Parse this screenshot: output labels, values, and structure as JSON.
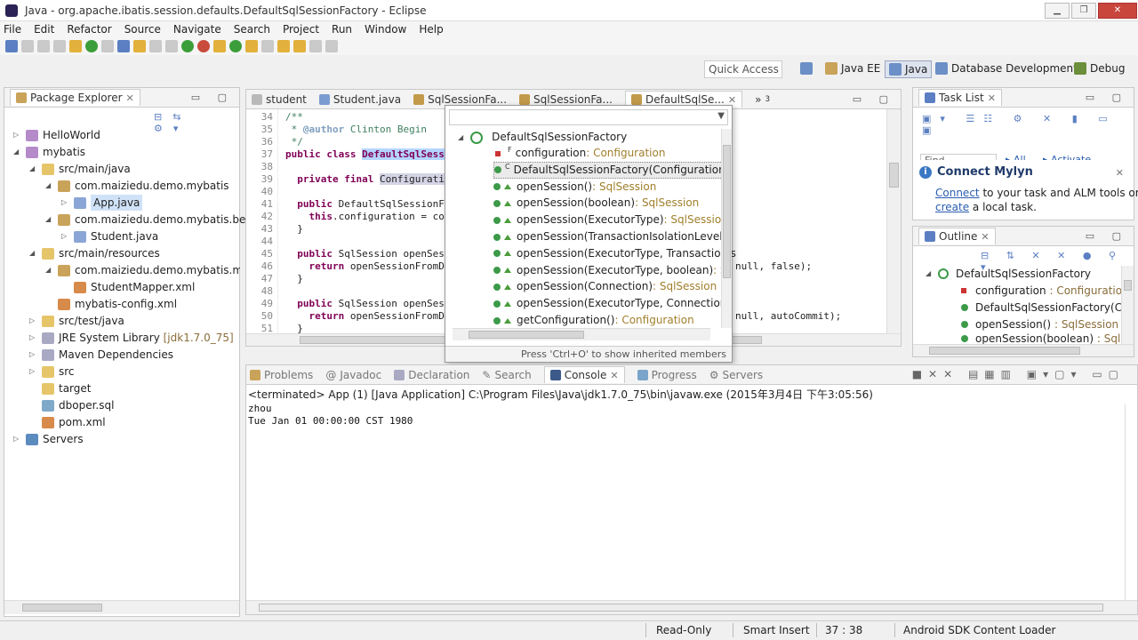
{
  "window": {
    "title": "Java - org.apache.ibatis.session.defaults.DefaultSqlSessionFactory - Eclipse"
  },
  "menu": [
    "File",
    "Edit",
    "Refactor",
    "Source",
    "Navigate",
    "Search",
    "Project",
    "Run",
    "Window",
    "Help"
  ],
  "quick_access": "Quick Access",
  "perspectives": [
    "Java EE",
    "Java",
    "Database Development",
    "Debug"
  ],
  "package_explorer": {
    "title": "Package Explorer",
    "tree": [
      {
        "label": "HelloWorld"
      },
      {
        "label": "mybatis"
      },
      {
        "label": "src/main/java"
      },
      {
        "label": "com.maiziedu.demo.mybatis"
      },
      {
        "label": "App.java"
      },
      {
        "label": "com.maiziedu.demo.mybatis.bean"
      },
      {
        "label": "Student.java"
      },
      {
        "label": "src/main/resources"
      },
      {
        "label": "com.maiziedu.demo.mybatis.mapper"
      },
      {
        "label": "StudentMapper.xml"
      },
      {
        "label": "mybatis-config.xml"
      },
      {
        "label": "src/test/java"
      },
      {
        "label": "JRE System Library",
        "suffix": "[jdk1.7.0_75]"
      },
      {
        "label": "Maven Dependencies"
      },
      {
        "label": "src"
      },
      {
        "label": "target"
      },
      {
        "label": "dboper.sql"
      },
      {
        "label": "pom.xml"
      },
      {
        "label": "Servers"
      }
    ]
  },
  "editor": {
    "tabs": [
      "student",
      "Student.java",
      "SqlSessionFa...",
      "SqlSessionFa...",
      "DefaultSqlSe..."
    ],
    "more_tabs": "3",
    "lines": [
      {
        "n": "34",
        "t": "/**"
      },
      {
        "n": "35",
        "t": " * @author Clinton Begin"
      },
      {
        "n": "36",
        "t": " */"
      },
      {
        "n": "37",
        "t": "public class DefaultSqlSess"
      },
      {
        "n": "38",
        "t": ""
      },
      {
        "n": "39",
        "t": "  private final Configurati"
      },
      {
        "n": "40",
        "t": ""
      },
      {
        "n": "41",
        "t": "  public DefaultSqlSessionF"
      },
      {
        "n": "42",
        "t": "    this.configuration = co"
      },
      {
        "n": "43",
        "t": "  }"
      },
      {
        "n": "44",
        "t": ""
      },
      {
        "n": "45",
        "t": "  public SqlSession openSes"
      },
      {
        "n": "46",
        "t": "    return openSessionFromD"
      },
      {
        "n": "47",
        "t": "  }"
      },
      {
        "n": "48",
        "t": ""
      },
      {
        "n": "49",
        "t": "  public SqlSession openSes"
      },
      {
        "n": "50",
        "t": "    return openSessionFromD"
      },
      {
        "n": "51",
        "t": "  }"
      },
      {
        "n": "52",
        "t": ""
      }
    ],
    "tail_46": "null, false);",
    "tail_50": "null, autoCommit);"
  },
  "quick_outline": {
    "root": "DefaultSqlSessionFactory",
    "items": [
      {
        "name": "configuration",
        "type": "Configuration"
      },
      {
        "name": "DefaultSqlSessionFactory(Configuration)",
        "type": ""
      },
      {
        "name": "openSession()",
        "type": "SqlSession"
      },
      {
        "name": "openSession(boolean)",
        "type": "SqlSession"
      },
      {
        "name": "openSession(ExecutorType)",
        "type": "SqlSession"
      },
      {
        "name": "openSession(TransactionIsolationLevel)",
        "type": ""
      },
      {
        "name": "openSession(ExecutorType, TransactionIs",
        "type": ""
      },
      {
        "name": "openSession(ExecutorType, boolean)",
        "type": "Sc"
      },
      {
        "name": "openSession(Connection)",
        "type": "SqlSession"
      },
      {
        "name": "openSession(ExecutorType, Connection)",
        "type": ""
      },
      {
        "name": "getConfiguration()",
        "type": "Configuration"
      }
    ],
    "hint": "Press 'Ctrl+O' to show inherited members"
  },
  "task_list": {
    "title": "Task List",
    "find": "Find",
    "all": "All",
    "activate": "Activate..."
  },
  "mylyn": {
    "title": "Connect Mylyn",
    "connect": "Connect",
    "text1": "to your task and ALM tools or",
    "create": "create",
    "text2": "a local task."
  },
  "outline": {
    "title": "Outline",
    "items": [
      {
        "label": "DefaultSqlSessionFactory",
        "type": ""
      },
      {
        "label": "configuration",
        "type": "Configuration"
      },
      {
        "label": "DefaultSqlSessionFactory(Co",
        "type": ""
      },
      {
        "label": "openSession()",
        "type": "SqlSession"
      },
      {
        "label": "openSession(boolean)",
        "type": "SqlS"
      }
    ]
  },
  "bottom_tabs": [
    "Problems",
    "Javadoc",
    "Declaration",
    "Search",
    "Console",
    "Progress",
    "Servers"
  ],
  "console": {
    "header": "<terminated> App (1) [Java Application] C:\\Program Files\\Java\\jdk1.7.0_75\\bin\\javaw.exe (2015年3月4日 下午3:05:56)",
    "output": [
      "zhou",
      "Tue Jan 01 00:00:00 CST 1980"
    ]
  },
  "status": {
    "mode": "Read-Only",
    "insert": "Smart Insert",
    "pos": "37 : 38",
    "loader": "Android SDK Content Loader"
  }
}
